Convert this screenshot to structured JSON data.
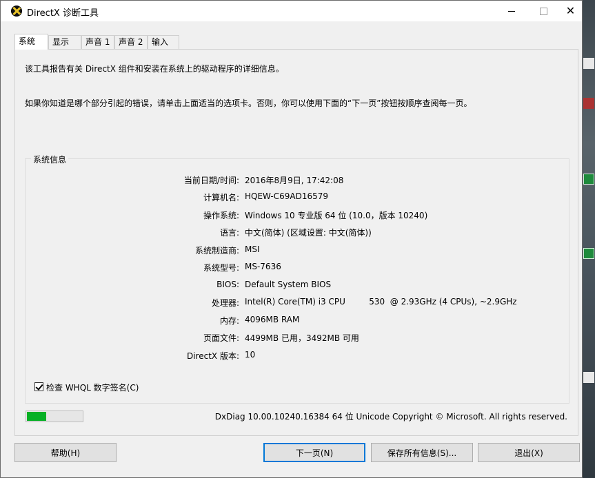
{
  "window": {
    "title": "DirectX 诊断工具"
  },
  "tabs": [
    {
      "label": "系统",
      "active": true
    },
    {
      "label": "显示",
      "active": false
    },
    {
      "label": "声音 1",
      "active": false
    },
    {
      "label": "声音 2",
      "active": false
    },
    {
      "label": "输入",
      "active": false
    }
  ],
  "intro": {
    "line1": "该工具报告有关 DirectX 组件和安装在系统上的驱动程序的详细信息。",
    "line2": "如果你知道是哪个部分引起的错误，请单击上面适当的选项卡。否则，你可以使用下面的“下一页”按钮按顺序查阅每一页。"
  },
  "system_info": {
    "title": "系统信息",
    "rows": [
      {
        "label": "当前日期/时间:",
        "value": "2016年8月9日, 17:42:08"
      },
      {
        "label": "计算机名:",
        "value": "HQEW-C69AD16579"
      },
      {
        "label": "操作系统:",
        "value": "Windows 10 专业版 64 位 (10.0，版本 10240)"
      },
      {
        "label": "语言:",
        "value": "中文(简体) (区域设置: 中文(简体))"
      },
      {
        "label": "系统制造商:",
        "value": "MSI"
      },
      {
        "label": "系统型号:",
        "value": "MS-7636"
      },
      {
        "label": "BIOS:",
        "value": "Default System BIOS"
      },
      {
        "label": "处理器:",
        "value": "Intel(R) Core(TM) i3 CPU         530  @ 2.93GHz (4 CPUs), ~2.9GHz"
      },
      {
        "label": "内存:",
        "value": "4096MB RAM"
      },
      {
        "label": "页面文件:",
        "value": "4499MB 已用，3492MB 可用"
      },
      {
        "label": "DirectX 版本:",
        "value": "10"
      }
    ]
  },
  "whql": {
    "label": "检查 WHQL 数字签名(C)",
    "checked": true
  },
  "progress": {
    "fraction": 0.35,
    "color": "#06b025"
  },
  "footer": {
    "version_text": "DxDiag 10.00.10240.16384 64 位 Unicode  Copyright © Microsoft. All rights reserved."
  },
  "buttons": {
    "help": "帮助(H)",
    "next": "下一页(N)",
    "save_all": "保存所有信息(S)...",
    "exit": "退出(X)"
  },
  "colors": {
    "accent": "#0078d7"
  },
  "icons": {
    "app": "directx-icon",
    "close": "close-icon",
    "min": "minimize-icon",
    "max": "maximize-icon"
  }
}
